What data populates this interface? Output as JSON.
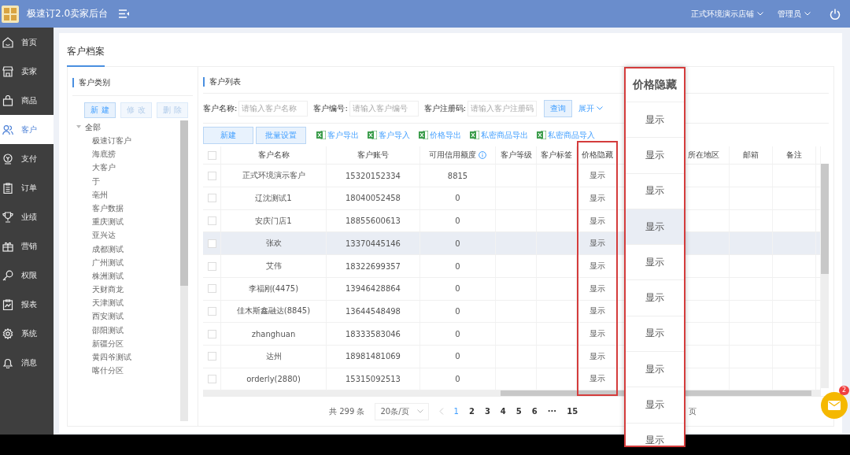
{
  "topbar": {
    "title": "极速订2.0卖家后台",
    "store": "正式环境演示店铺",
    "user": "管理员"
  },
  "sidebar": {
    "items": [
      {
        "label": "首页",
        "selected": false
      },
      {
        "label": "卖家",
        "selected": false
      },
      {
        "label": "商品",
        "selected": false
      },
      {
        "label": "客户",
        "selected": true
      },
      {
        "label": "支付",
        "selected": false
      },
      {
        "label": "订单",
        "selected": false
      },
      {
        "label": "业绩",
        "selected": false
      },
      {
        "label": "营销",
        "selected": false
      },
      {
        "label": "权限",
        "selected": false
      },
      {
        "label": "报表",
        "selected": false
      },
      {
        "label": "系统",
        "selected": false
      },
      {
        "label": "消息",
        "selected": false
      }
    ]
  },
  "page": {
    "title": "客户档案"
  },
  "categories": {
    "title": "客户类别",
    "buttons": [
      {
        "label": "新 建",
        "disabled": false
      },
      {
        "label": "修 改",
        "disabled": true
      },
      {
        "label": "删 除",
        "disabled": true
      }
    ],
    "tree": [
      {
        "label": "全部",
        "expanded": true,
        "children": [
          {
            "label": "极速订客户"
          },
          {
            "label": "海底捞"
          },
          {
            "label": "大客户"
          },
          {
            "label": "于"
          },
          {
            "label": "亳州"
          },
          {
            "label": "客户数据"
          },
          {
            "label": "重庆测试"
          },
          {
            "label": "亚兴达"
          },
          {
            "label": "成都测试"
          },
          {
            "label": "广州测试"
          },
          {
            "label": "株洲测试"
          },
          {
            "label": "天财商龙"
          },
          {
            "label": "天津测试"
          },
          {
            "label": "西安测试"
          },
          {
            "label": "邵阳测试"
          },
          {
            "label": "新疆分区"
          },
          {
            "label": "黄四爷测试"
          },
          {
            "label": "喀什分区"
          }
        ]
      }
    ]
  },
  "list": {
    "title": "客户列表",
    "filters": [
      {
        "label": "客户名称:",
        "placeholder": "请输入客户名称"
      },
      {
        "label": "客户编号:",
        "placeholder": "请输入客户编号"
      },
      {
        "label": "客户注册码:",
        "placeholder": "请输入客户注册码"
      }
    ],
    "search_button": "查询",
    "expand_link": "展开",
    "buttons": [
      "新建",
      "批量设置"
    ],
    "links": [
      "客户导出",
      "客户导入",
      "价格导出",
      "私密商品导出",
      "私密商品导入"
    ],
    "header_checked": false,
    "columns": [
      {
        "label": "客户名称",
        "info": false
      },
      {
        "label": "客户账号",
        "info": false
      },
      {
        "label": "可用信用额度",
        "info": true
      },
      {
        "label": "客户等级",
        "info": false
      },
      {
        "label": "客户标签",
        "info": false
      },
      {
        "label": "价格隐藏",
        "info": false
      },
      {
        "label": "所在地区",
        "info": false
      },
      {
        "label": "邮箱",
        "info": false
      },
      {
        "label": "备注",
        "info": false
      }
    ],
    "rows": [
      {
        "checked": false,
        "hovered": false,
        "name": "正式环境演示客户",
        "account": "15320152334",
        "credit": "8815",
        "price": "显示"
      },
      {
        "checked": false,
        "hovered": false,
        "name": "辽沈测试1",
        "account": "18040052458",
        "credit": "0",
        "price": "显示"
      },
      {
        "checked": false,
        "hovered": false,
        "name": "安庆门店1",
        "account": "18855600613",
        "credit": "0",
        "price": "显示"
      },
      {
        "checked": false,
        "hovered": true,
        "name": "张欢",
        "account": "13370445146",
        "credit": "0",
        "price": "显示"
      },
      {
        "checked": false,
        "hovered": false,
        "name": "艾伟",
        "account": "18322699357",
        "credit": "0",
        "price": "显示"
      },
      {
        "checked": false,
        "hovered": false,
        "name": "李福刚(4475)",
        "account": "13946428864",
        "credit": "0",
        "price": "显示"
      },
      {
        "checked": false,
        "hovered": false,
        "name": "佳木斯鑫融达(8845)",
        "account": "13644548498",
        "credit": "0",
        "price": "显示"
      },
      {
        "checked": false,
        "hovered": false,
        "name": "zhanghuan",
        "account": "18333583046",
        "credit": "0",
        "price": "显示"
      },
      {
        "checked": false,
        "hovered": false,
        "name": "达州",
        "account": "18981481069",
        "credit": "0",
        "price": "显示"
      },
      {
        "checked": false,
        "hovered": false,
        "name": "orderly(2880)",
        "account": "15315092513",
        "credit": "0",
        "price": "显示"
      }
    ],
    "pagination": {
      "total": "共 299 条",
      "page_size": "20条/页",
      "pages": [
        {
          "label": "1",
          "selected": true
        },
        {
          "label": "2",
          "selected": false
        },
        {
          "label": "3",
          "selected": false
        },
        {
          "label": "4",
          "selected": false
        },
        {
          "label": "5",
          "selected": false
        },
        {
          "label": "6",
          "selected": false
        },
        {
          "label": "···",
          "selected": false
        },
        {
          "label": "15",
          "selected": false
        }
      ],
      "suffix": "页"
    }
  },
  "callout": {
    "title": "价格隐藏",
    "cells": [
      {
        "text": "显示",
        "hovered": false
      },
      {
        "text": "显示",
        "hovered": false
      },
      {
        "text": "显示",
        "hovered": false
      },
      {
        "text": "显示",
        "hovered": true
      },
      {
        "text": "显示",
        "hovered": false
      },
      {
        "text": "显示",
        "hovered": false
      },
      {
        "text": "显示",
        "hovered": false
      },
      {
        "text": "显示",
        "hovered": false
      },
      {
        "text": "显示",
        "hovered": false
      },
      {
        "text": "显示",
        "hovered": false
      }
    ]
  },
  "mail": {
    "badge": "2"
  }
}
